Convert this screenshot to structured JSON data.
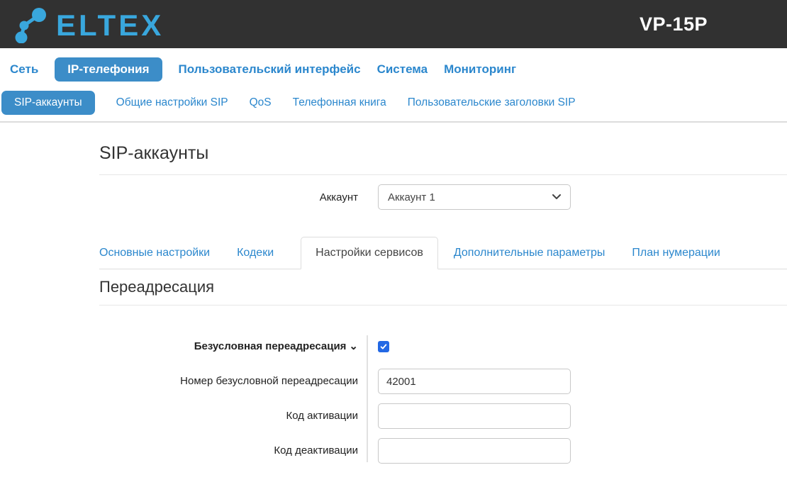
{
  "colors": {
    "header_bg": "#313131",
    "logo_blue": "#39a7dd",
    "link_blue": "#2b87cd",
    "accent_pill_blue": "#3c8dc8",
    "checkbox_blue": "#2368e4"
  },
  "header": {
    "brand": "ELTEX",
    "model": "VP-15P"
  },
  "main_nav": {
    "items": [
      {
        "label": "Сеть",
        "active": false
      },
      {
        "label": "IP-телефония",
        "active": true
      },
      {
        "label": "Пользовательский интерфейс",
        "active": false
      },
      {
        "label": "Система",
        "active": false
      },
      {
        "label": "Мониторинг",
        "active": false
      }
    ]
  },
  "sub_nav": {
    "items": [
      {
        "label": "SIP-аккаунты",
        "active": true
      },
      {
        "label": "Общие настройки SIP",
        "active": false
      },
      {
        "label": "QoS",
        "active": false
      },
      {
        "label": "Телефонная книга",
        "active": false
      },
      {
        "label": "Пользовательские заголовки SIP",
        "active": false
      }
    ]
  },
  "page": {
    "title": "SIP-аккаунты"
  },
  "account_selector": {
    "label": "Аккаунт",
    "selected_option": "Аккаунт 1"
  },
  "tabs": {
    "items": [
      {
        "label": "Основные настройки",
        "active": false
      },
      {
        "label": "Кодеки",
        "active": false
      },
      {
        "label": "Настройки сервисов",
        "active": true
      },
      {
        "label": "Дополнительные параметры",
        "active": false
      },
      {
        "label": "План нумерации",
        "active": false
      }
    ]
  },
  "section": {
    "title": "Переадресация"
  },
  "form": {
    "rows": [
      {
        "label": "Безусловная переадресация",
        "collapse_icon": "⌄",
        "type": "checkbox",
        "checked": true
      },
      {
        "label": "Номер безусловной переадресации",
        "type": "text",
        "value": "42001"
      },
      {
        "label": "Код активации",
        "type": "text",
        "value": ""
      },
      {
        "label": "Код деактивации",
        "type": "text",
        "value": ""
      }
    ]
  }
}
